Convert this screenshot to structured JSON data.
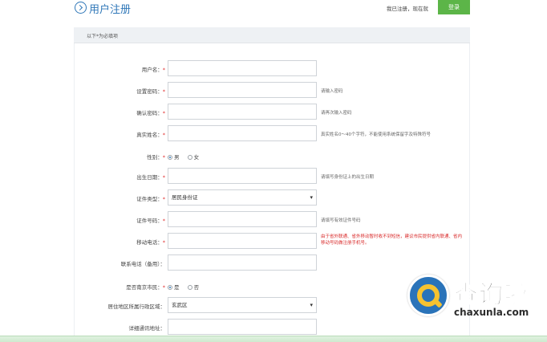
{
  "header": {
    "title": "用户注册",
    "login_hint": "我已注册，现在就",
    "login_label": "登录"
  },
  "notice": "以下*为必填项",
  "form": {
    "username": {
      "label": "用户名：",
      "required": "*",
      "value": ""
    },
    "password": {
      "label": "设置密码：",
      "required": "*",
      "value": "",
      "hint": "请输入密码"
    },
    "confirm": {
      "label": "确认密码：",
      "required": "*",
      "value": "",
      "hint": "请再次输入密码"
    },
    "realname": {
      "label": "真实姓名：",
      "required": "*",
      "value": "",
      "hint": "真实姓名0～40个字符，不能使用系统保留字及特殊符号"
    },
    "gender": {
      "label": "性别：",
      "required": "*",
      "options": [
        "男",
        "女"
      ],
      "selected": "男"
    },
    "birthday": {
      "label": "出生日期：",
      "required": "*",
      "value": "",
      "hint": "请填写身份证上的出生日期"
    },
    "idtype": {
      "label": "证件类型：",
      "required": "*",
      "value": "居民身份证"
    },
    "idnumber": {
      "label": "证件号码：",
      "required": "*",
      "value": "",
      "hint": "请填写有效证件号码"
    },
    "mobile": {
      "label": "移动电话：",
      "required": "*",
      "value": "",
      "hint": "由于省外联通、省外移动暂时收不到短信，建议市民提供省内联通、省内移动号码做注册手机号。"
    },
    "phone": {
      "label": "联系电话（备用）：",
      "value": ""
    },
    "resident": {
      "label": "是否南京市民：",
      "required": "*",
      "options": [
        "是",
        "否"
      ],
      "selected": "是"
    },
    "district": {
      "label": "居住地区所属行政区域：",
      "value": "玄武区"
    },
    "address": {
      "label": "详细通讯地址：",
      "value": ""
    }
  },
  "watermark": {
    "cn": "查询啦",
    "en": "chaxunla.com"
  },
  "colors": {
    "accent": "#2f77b8",
    "login_button": "#5cb548",
    "required": "#e03030",
    "warning_text": "#d92b2b"
  }
}
